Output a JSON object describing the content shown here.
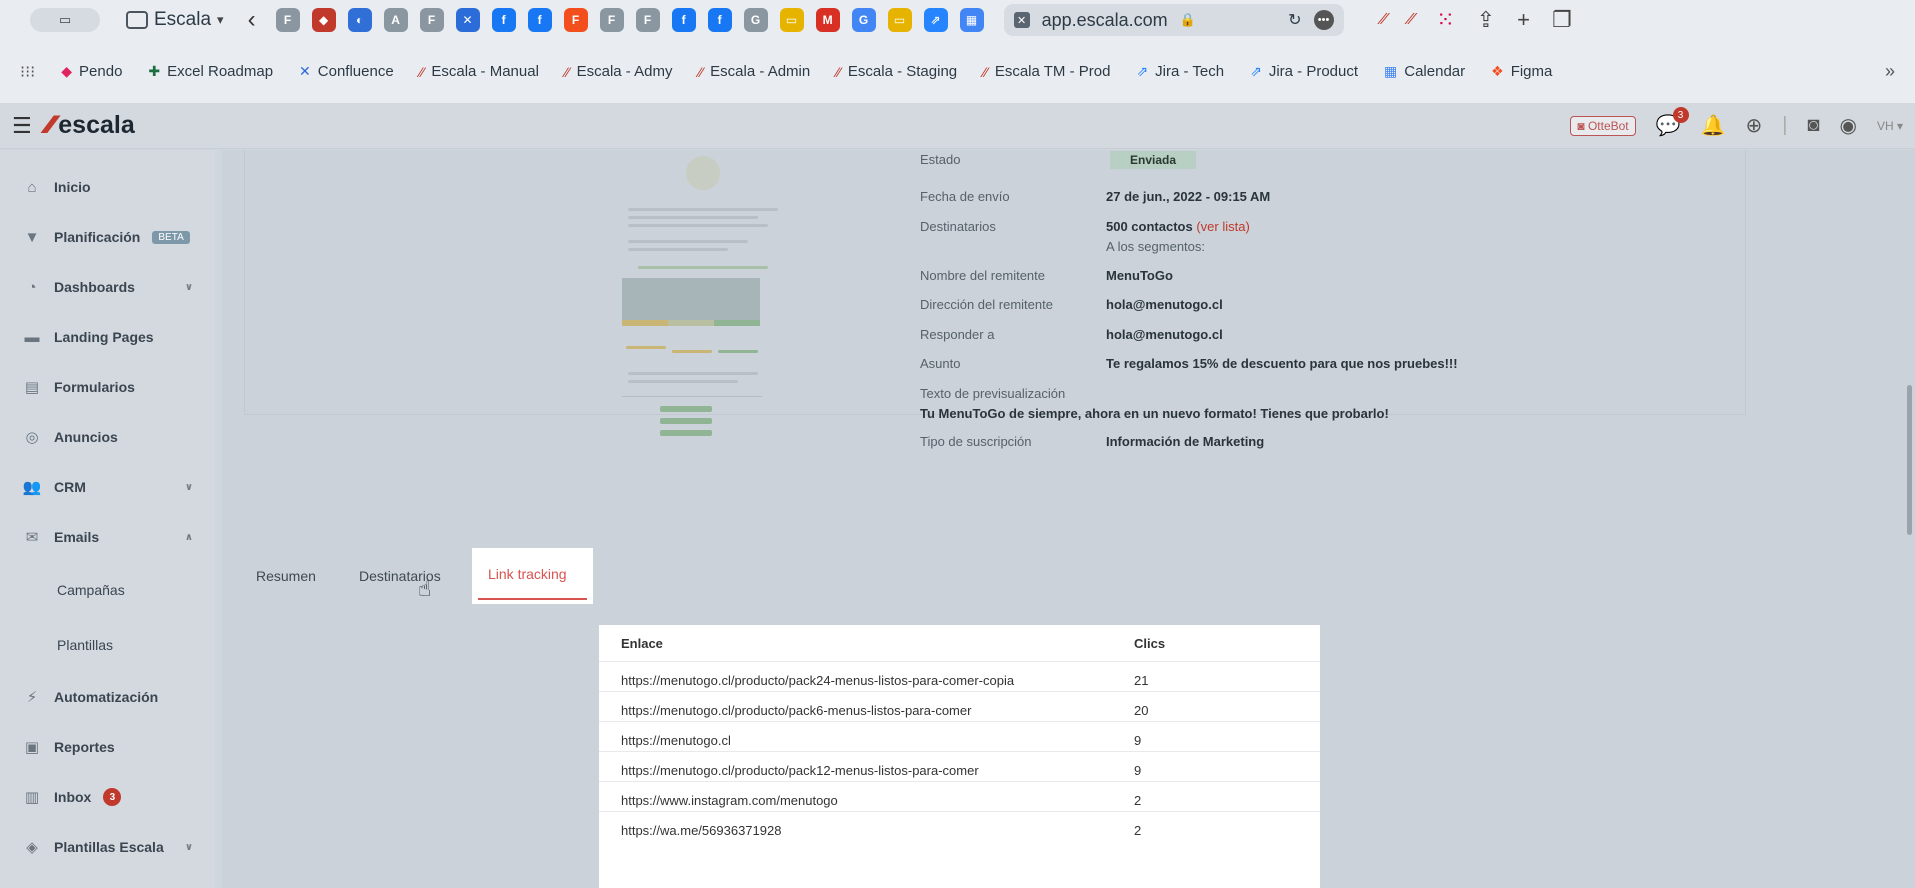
{
  "browser": {
    "tab_group": "Escala",
    "url": "app.escala.com",
    "tab_icons": [
      {
        "name": "f-icon",
        "color": "#8a96a0",
        "glyph": "F"
      },
      {
        "name": "red-app-icon",
        "color": "#c0392b",
        "glyph": "◆"
      },
      {
        "name": "swirl-icon",
        "color": "#2f6fd6",
        "glyph": "◐"
      },
      {
        "name": "a-icon",
        "color": "#8a96a0",
        "glyph": "A"
      },
      {
        "name": "f-icon",
        "color": "#8a96a0",
        "glyph": "F"
      },
      {
        "name": "confluence-icon",
        "color": "#2b6cd8",
        "glyph": "✕"
      },
      {
        "name": "facebook-icon",
        "color": "#1877f2",
        "glyph": "f"
      },
      {
        "name": "facebook-icon",
        "color": "#1877f2",
        "glyph": "f"
      },
      {
        "name": "figma-icon",
        "color": "#f24e1e",
        "glyph": "F"
      },
      {
        "name": "f-icon",
        "color": "#8a96a0",
        "glyph": "F"
      },
      {
        "name": "f-icon",
        "color": "#8a96a0",
        "glyph": "F"
      },
      {
        "name": "facebook-icon",
        "color": "#1877f2",
        "glyph": "f"
      },
      {
        "name": "facebook-icon",
        "color": "#1877f2",
        "glyph": "f"
      },
      {
        "name": "g-icon",
        "color": "#8a96a0",
        "glyph": "G"
      },
      {
        "name": "slides-icon",
        "color": "#e6b400",
        "glyph": "▭"
      },
      {
        "name": "gmail-icon",
        "color": "#d93025",
        "glyph": "M"
      },
      {
        "name": "google-icon",
        "color": "#4285f4",
        "glyph": "G"
      },
      {
        "name": "slides-icon",
        "color": "#e6b400",
        "glyph": "▭"
      },
      {
        "name": "jira-icon",
        "color": "#2684ff",
        "glyph": "⇗"
      },
      {
        "name": "calendar-icon",
        "color": "#4285f4",
        "glyph": "▦"
      }
    ]
  },
  "bookmarks": [
    {
      "label": "Pendo",
      "icon": "pendo-icon",
      "color": "#e0245e",
      "glyph": "◆"
    },
    {
      "label": "Excel Roadmap",
      "icon": "excel-icon",
      "color": "#1d6f42",
      "glyph": "✚"
    },
    {
      "label": "Confluence",
      "icon": "confluence-icon",
      "color": "#2b6cd8",
      "glyph": "✕"
    },
    {
      "label": "Escala - Manual",
      "icon": "escala-icon",
      "color": "#c0392b",
      "glyph": "⁄⁄"
    },
    {
      "label": "Escala - Admy",
      "icon": "escala-icon",
      "color": "#c0392b",
      "glyph": "⁄⁄"
    },
    {
      "label": "Escala - Admin",
      "icon": "escala-icon",
      "color": "#c0392b",
      "glyph": "⁄⁄"
    },
    {
      "label": "Escala - Staging",
      "icon": "escala-icon",
      "color": "#c0392b",
      "glyph": "⁄⁄"
    },
    {
      "label": "Escala TM - Prod",
      "icon": "escala-icon",
      "color": "#c0392b",
      "glyph": "⁄⁄"
    },
    {
      "label": "Jira - Tech",
      "icon": "jira-icon",
      "color": "#2684ff",
      "glyph": "⇗"
    },
    {
      "label": "Jira - Product",
      "icon": "jira-icon",
      "color": "#2684ff",
      "glyph": "⇗"
    },
    {
      "label": "Calendar",
      "icon": "calendar-icon",
      "color": "#4285f4",
      "glyph": "▦"
    },
    {
      "label": "Figma",
      "icon": "figma-icon",
      "color": "#f24e1e",
      "glyph": "❖"
    }
  ],
  "header": {
    "logo_text": "escala",
    "ottebot_label": "OtteBot",
    "messages_count": "3",
    "avatar_label": "VH"
  },
  "sidebar": {
    "items": [
      {
        "label": "Inicio",
        "icon": "home-icon",
        "glyph": "⌂"
      },
      {
        "label": "Planificación",
        "icon": "filter-icon",
        "glyph": "▼",
        "badge": "BETA"
      },
      {
        "label": "Dashboards",
        "icon": "chart-icon",
        "glyph": "◔",
        "chevron": "∨"
      },
      {
        "label": "Landing Pages",
        "icon": "folder-icon",
        "glyph": "▬"
      },
      {
        "label": "Formularios",
        "icon": "form-icon",
        "glyph": "▤"
      },
      {
        "label": "Anuncios",
        "icon": "target-icon",
        "glyph": "◎"
      },
      {
        "label": "CRM",
        "icon": "people-icon",
        "glyph": "👥",
        "chevron": "∨"
      },
      {
        "label": "Emails",
        "icon": "mail-icon",
        "glyph": "✉",
        "chevron": "∧"
      }
    ],
    "email_sub": [
      "Campañas",
      "Plantillas"
    ],
    "items_after": [
      {
        "label": "Automatización",
        "icon": "bolt-icon",
        "glyph": "⚡"
      },
      {
        "label": "Reportes",
        "icon": "report-icon",
        "glyph": "▣"
      },
      {
        "label": "Inbox",
        "icon": "inbox-icon",
        "glyph": "▥",
        "count": "3"
      },
      {
        "label": "Plantillas Escala",
        "icon": "stack-icon",
        "glyph": "◈",
        "chevron": "∨"
      }
    ]
  },
  "details": {
    "estado_label": "Estado",
    "estado_value": "Enviada",
    "fecha_label": "Fecha de envío",
    "fecha_value": "27 de jun., 2022 - 09:15 AM",
    "destinatarios_label": "Destinatarios",
    "destinatarios_value": "500 contactos",
    "ver_lista": "(ver lista)",
    "segmentos": "A los segmentos:",
    "remitente_label": "Nombre del remitente",
    "remitente_value": "MenuToGo",
    "direccion_label": "Dirección del remitente",
    "direccion_value": "hola@menutogo.cl",
    "responder_label": "Responder a",
    "responder_value": "hola@menutogo.cl",
    "asunto_label": "Asunto",
    "asunto_value": "Te regalamos 15% de descuento para que nos pruebes!!!",
    "preview_label": "Texto de previsualización",
    "preview_value": "Tu MenuToGo de siempre, ahora en un nuevo formato! Tienes que probarlo!",
    "tipo_label": "Tipo de suscripción",
    "tipo_value": "Información de Marketing"
  },
  "tabs": {
    "resumen": "Resumen",
    "destinatarios": "Destinatarios",
    "link_tracking": "Link tracking"
  },
  "table": {
    "col_enlace": "Enlace",
    "col_clics": "Clics",
    "rows": [
      {
        "url": "https://menutogo.cl/producto/pack24-menus-listos-para-comer-copia",
        "clicks": "21"
      },
      {
        "url": "https://menutogo.cl/producto/pack6-menus-listos-para-comer",
        "clicks": "20"
      },
      {
        "url": "https://menutogo.cl",
        "clicks": "9"
      },
      {
        "url": "https://menutogo.cl/producto/pack12-menus-listos-para-comer",
        "clicks": "9"
      },
      {
        "url": "https://www.instagram.com/menutogo",
        "clicks": "2"
      },
      {
        "url": "https://wa.me/56936371928",
        "clicks": "2"
      }
    ]
  }
}
